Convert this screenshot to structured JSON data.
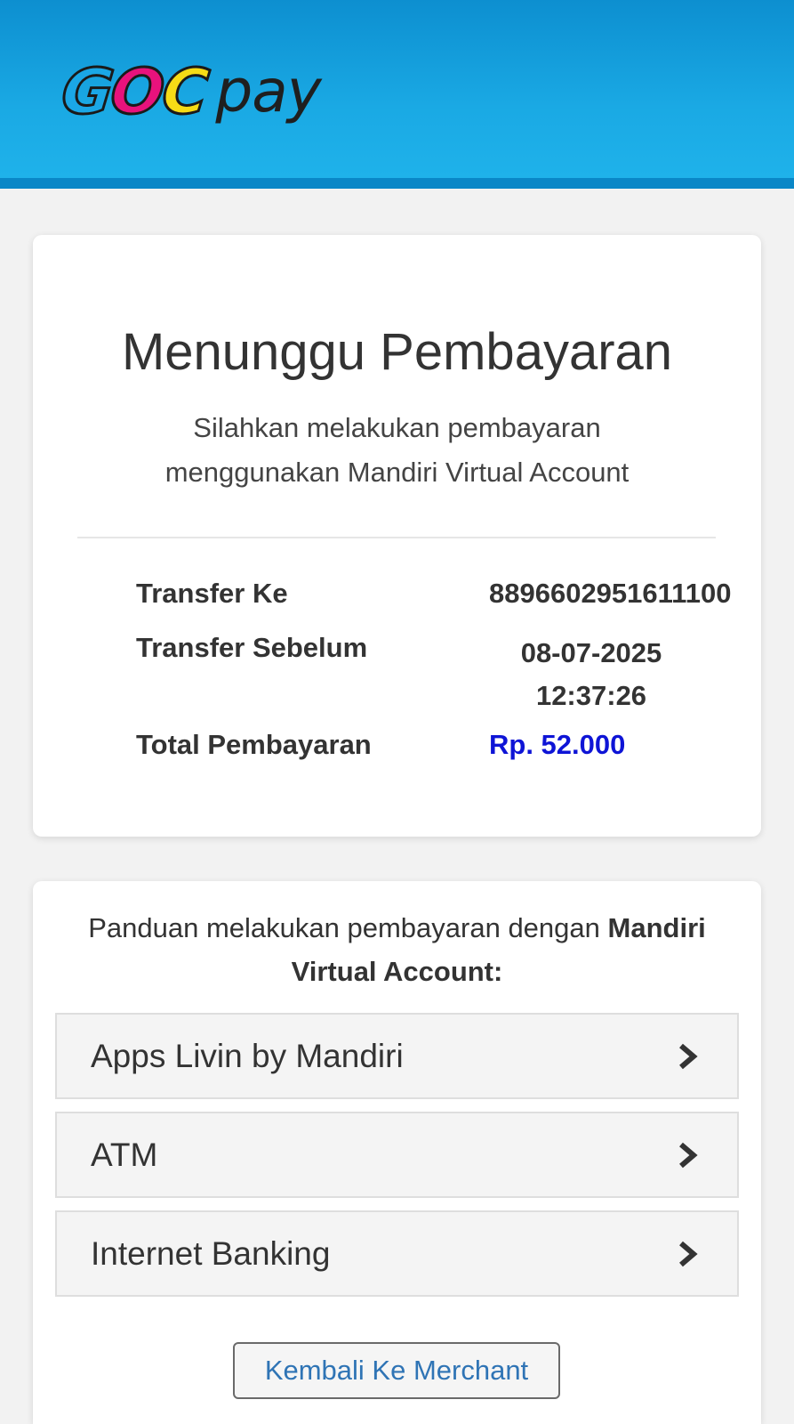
{
  "header": {
    "logo": {
      "letters": [
        "G",
        "O",
        "C"
      ],
      "suffix": "pay",
      "colors": {
        "g": "#1aa7e6",
        "o": "#e8127c",
        "c": "#f6dc16"
      }
    },
    "background_color": "#1aa9e4"
  },
  "status_card": {
    "title": "Menunggu Pembayaran",
    "subtitle_line1": "Silahkan melakukan pembayaran",
    "subtitle_line2": "menggunakan Mandiri Virtual Account",
    "rows": [
      {
        "label": "Transfer Ke",
        "value": "8896602951611100"
      },
      {
        "label": "Transfer Sebelum",
        "value_line1": "08-07-2025",
        "value_line2": "12:37:26"
      },
      {
        "label": "Total Pembayaran",
        "value": "Rp. 52.000",
        "value_color": "#0e14d6"
      }
    ]
  },
  "guide_card": {
    "intro": "Panduan melakukan pembayaran dengan",
    "intro_bold": "Mandiri Virtual Account:",
    "methods": [
      {
        "label": "Apps Livin by Mandiri",
        "icon": "chevron-right-icon"
      },
      {
        "label": "ATM",
        "icon": "chevron-right-icon"
      },
      {
        "label": "Internet Banking",
        "icon": "chevron-right-icon"
      }
    ],
    "back_button": "Kembali Ke Merchant"
  }
}
